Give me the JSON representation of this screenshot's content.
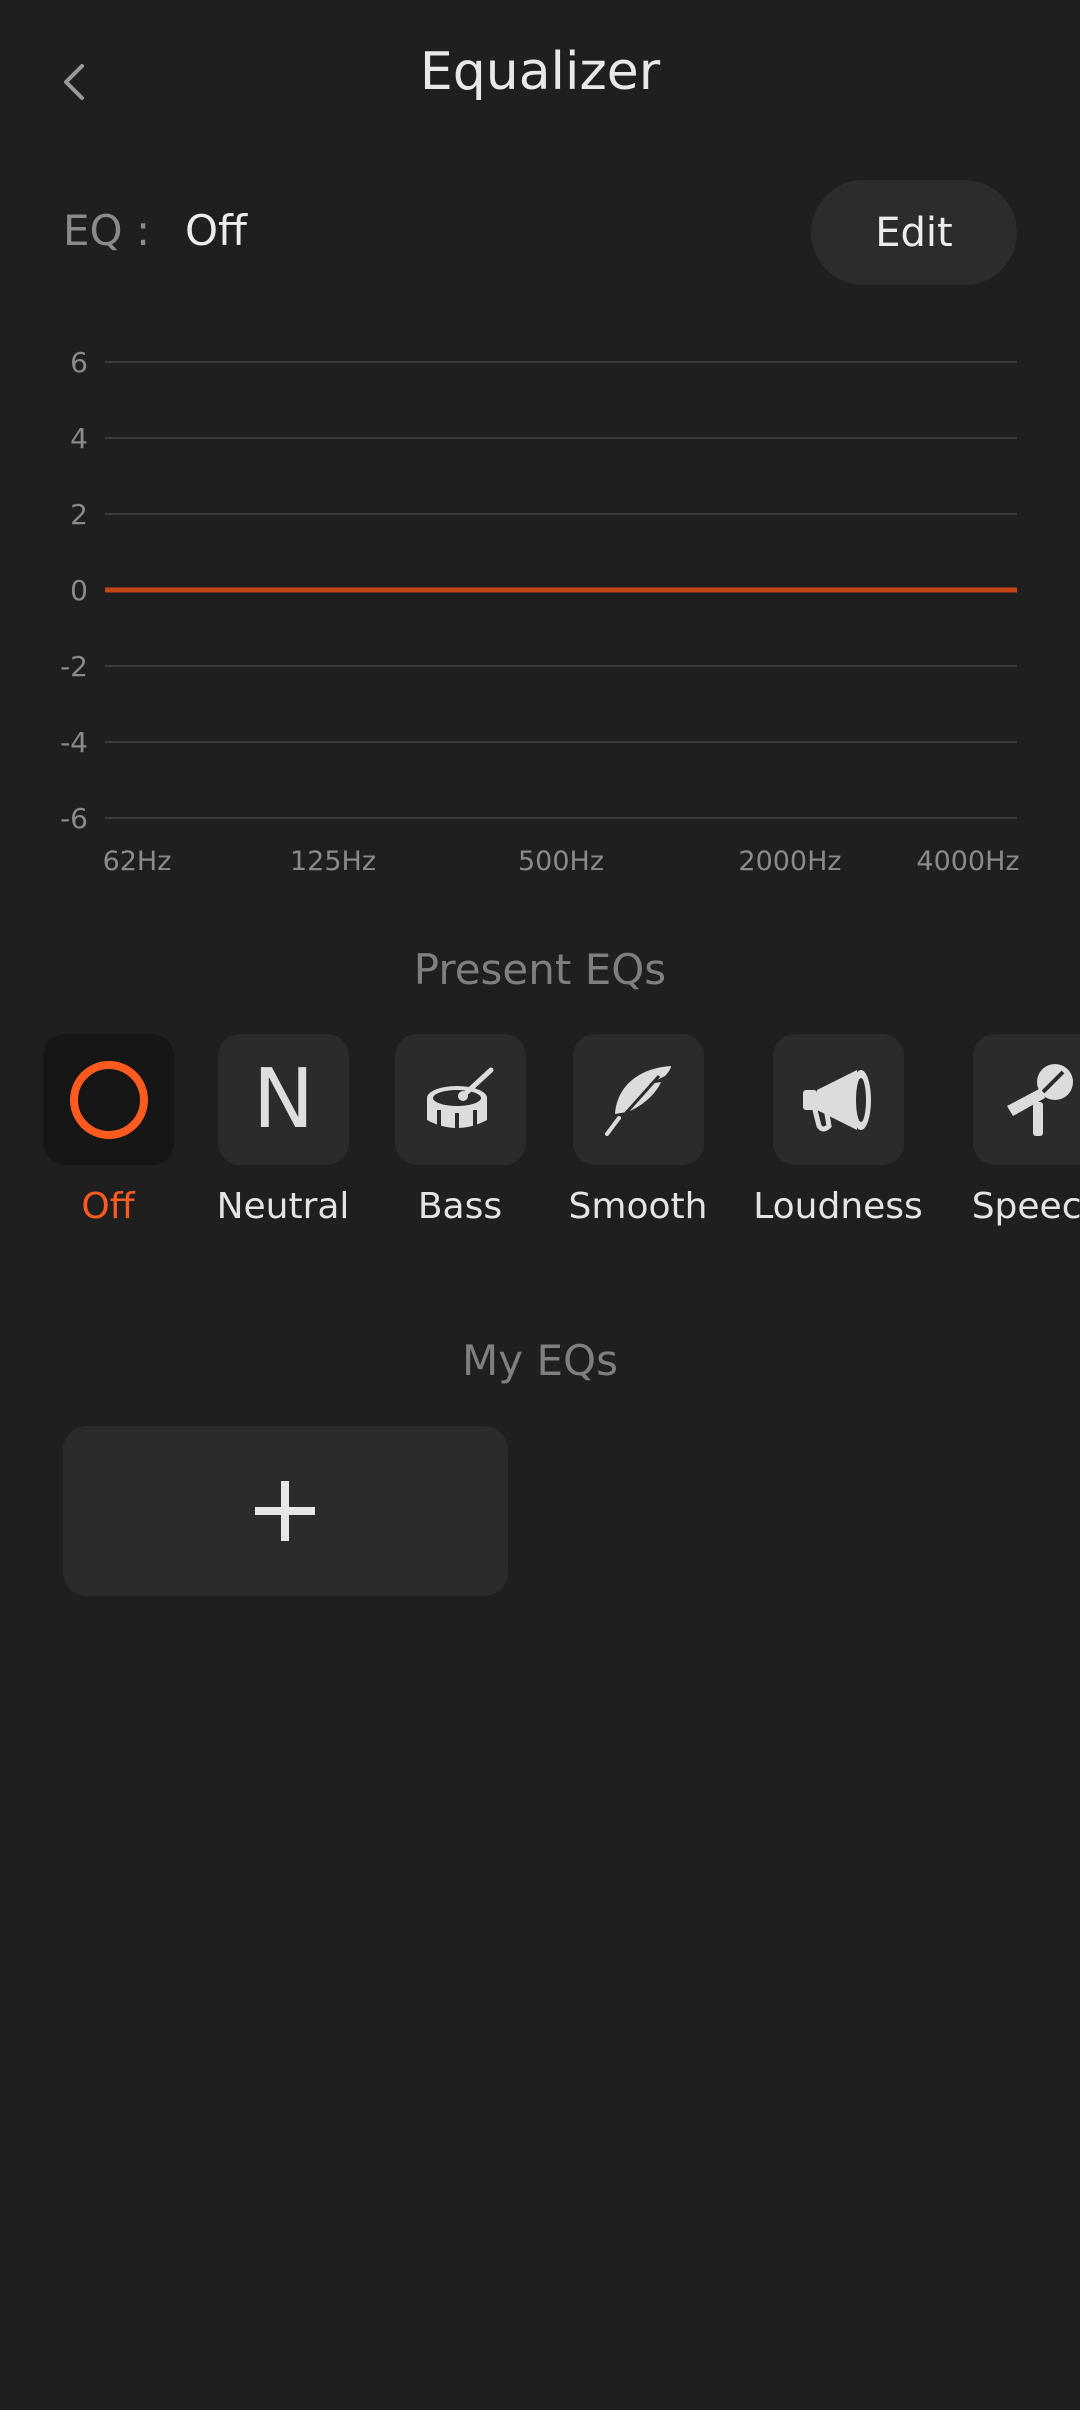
{
  "header": {
    "title": "Equalizer"
  },
  "eq": {
    "label": "EQ :",
    "value": "Off",
    "edit_label": "Edit"
  },
  "chart_data": {
    "type": "line",
    "x": [
      "62Hz",
      "125Hz",
      "500Hz",
      "2000Hz",
      "4000Hz"
    ],
    "series": [
      {
        "values": [
          0,
          0,
          0,
          0,
          0
        ]
      }
    ],
    "y_ticks": [
      "6",
      "4",
      "2",
      "0",
      "-2",
      "-4",
      "-6"
    ],
    "ylim": [
      -6,
      6
    ],
    "grid": true,
    "colors": {
      "line": "#c4461a",
      "grid": "#3a3a3a",
      "tick": "#8a8a8a"
    }
  },
  "presets_section": {
    "title": "Present EQs"
  },
  "presets": [
    {
      "label": "Off",
      "icon": "ring-icon",
      "active": true
    },
    {
      "label": "Neutral",
      "icon": "letter-n-icon",
      "glyph": "N"
    },
    {
      "label": "Bass",
      "icon": "drum-icon"
    },
    {
      "label": "Smooth",
      "icon": "feather-icon"
    },
    {
      "label": "Loudness",
      "icon": "megaphone-icon"
    },
    {
      "label": "Speech",
      "icon": "microphone-icon"
    }
  ],
  "my_eqs": {
    "title": "My EQs",
    "add_icon": "plus-icon"
  },
  "colors": {
    "accent": "#ff5a1f",
    "background": "#1f1f1f",
    "tile": "#2b2b2b"
  }
}
